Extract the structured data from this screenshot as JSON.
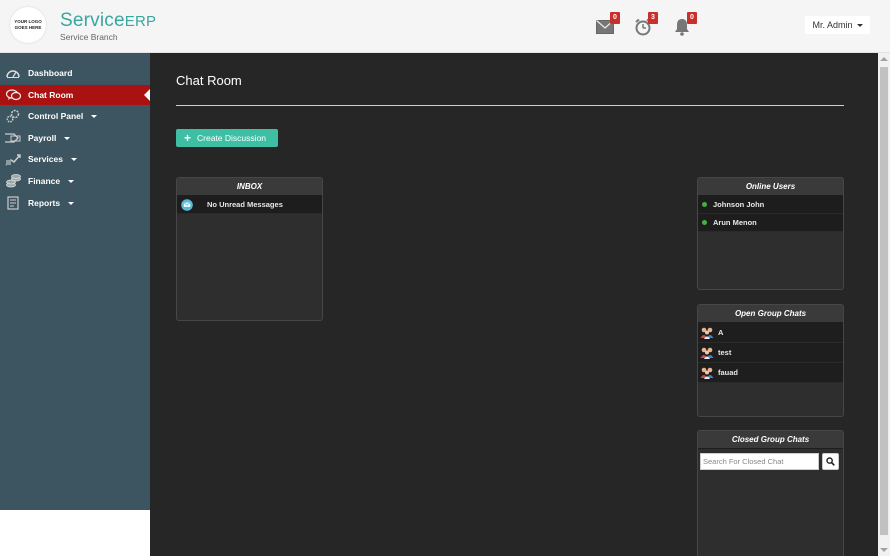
{
  "header": {
    "logo_line1": "YOUR LOGO",
    "logo_line2": "GOES HERE",
    "brand_main": "Service",
    "brand_suffix": "ERP",
    "brand_sub": "Service Branch",
    "messages_count": "0",
    "reminders_count": "3",
    "notifications_count": "0",
    "user_label": "Mr. Admin"
  },
  "sidebar": {
    "items": [
      {
        "label": "Dashboard",
        "icon": "dashboard-icon"
      },
      {
        "label": "Chat Room",
        "icon": "chat-icon"
      },
      {
        "label": "Control Panel",
        "icon": "gears-icon"
      },
      {
        "label": "Payroll",
        "icon": "payroll-icon"
      },
      {
        "label": "Services",
        "icon": "services-icon"
      },
      {
        "label": "Finance",
        "icon": "coins-icon"
      },
      {
        "label": "Reports",
        "icon": "report-icon"
      }
    ]
  },
  "main": {
    "title": "Chat Room",
    "create_label": "Create Discussion",
    "inbox": {
      "title": "INBOX",
      "message": "No Unread Messages"
    },
    "online_users": {
      "title": "Online Users",
      "users": [
        "Johnson John",
        "Arun Menon"
      ]
    },
    "open_groups": {
      "title": "Open Group Chats",
      "groups": [
        "A",
        "test",
        "fauad"
      ]
    },
    "closed_groups": {
      "title": "Closed Group Chats",
      "search_placeholder": "Search For Closed Chat"
    }
  },
  "colors": {
    "brand": "#3aa6a0",
    "sidebar_bg": "#3c5560",
    "active_item": "#aa1111",
    "main_bg": "#262626",
    "create_button": "#3ebfa4",
    "badge": "#c9302c",
    "online_dot": "#44b044"
  }
}
